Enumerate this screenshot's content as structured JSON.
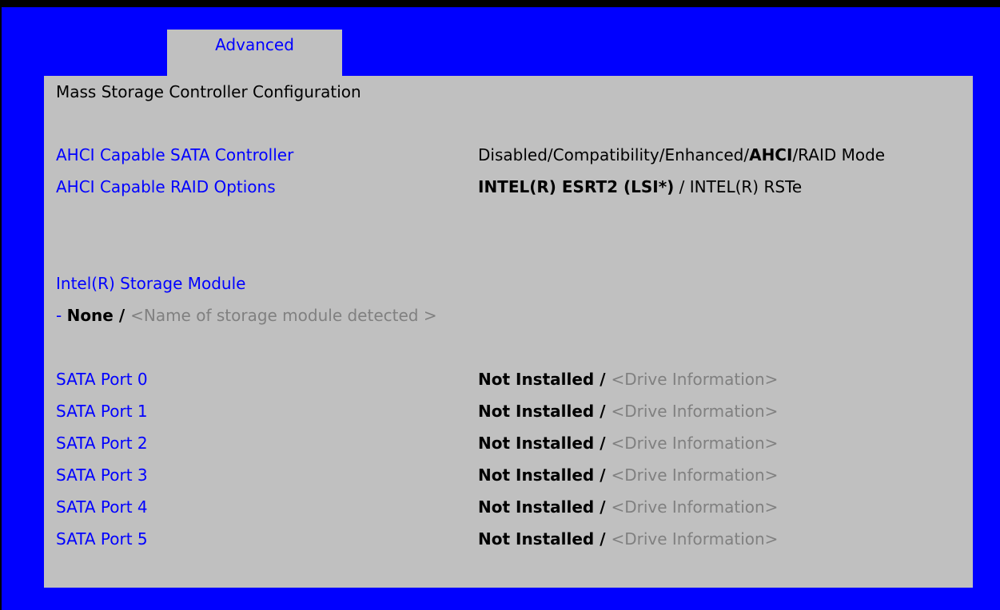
{
  "tabs": {
    "active": "Advanced"
  },
  "page_title": "Mass Storage Controller Configuration",
  "ahci_controller": {
    "label": "AHCI Capable SATA Controller",
    "options_before": "Disabled/Compatibility/Enhanced/",
    "selected": "AHCI",
    "options_after": "/RAID Mode"
  },
  "raid_options": {
    "label": "AHCI Capable RAID Options",
    "selected": "INTEL(R) ESRT2 (LSI*)",
    "options_after": " / INTEL(R) RSTe"
  },
  "storage_module": {
    "label": "Intel(R) Storage Module",
    "dash": "- ",
    "value": "None",
    "sep": " / ",
    "placeholder": "<Name of storage module detected >"
  },
  "sata_ports": [
    {
      "label": "SATA Port 0",
      "status": "Not Installed",
      "sep": " / ",
      "info": "<Drive Information>"
    },
    {
      "label": "SATA Port 1",
      "status": "Not Installed",
      "sep": " / ",
      "info": "<Drive Information>"
    },
    {
      "label": "SATA Port 2",
      "status": "Not Installed",
      "sep": " / ",
      "info": "<Drive Information>"
    },
    {
      "label": "SATA Port 3",
      "status": "Not Installed",
      "sep": " / ",
      "info": "<Drive Information>"
    },
    {
      "label": "SATA Port 4",
      "status": "Not Installed",
      "sep": " / ",
      "info": "<Drive Information>"
    },
    {
      "label": "SATA Port 5",
      "status": "Not Installed",
      "sep": " / ",
      "info": "<Drive Information>"
    }
  ],
  "colors": {
    "background": "#0000ff",
    "panel": "#c0c0c0",
    "label": "#0000ff",
    "placeholder": "#808080"
  }
}
